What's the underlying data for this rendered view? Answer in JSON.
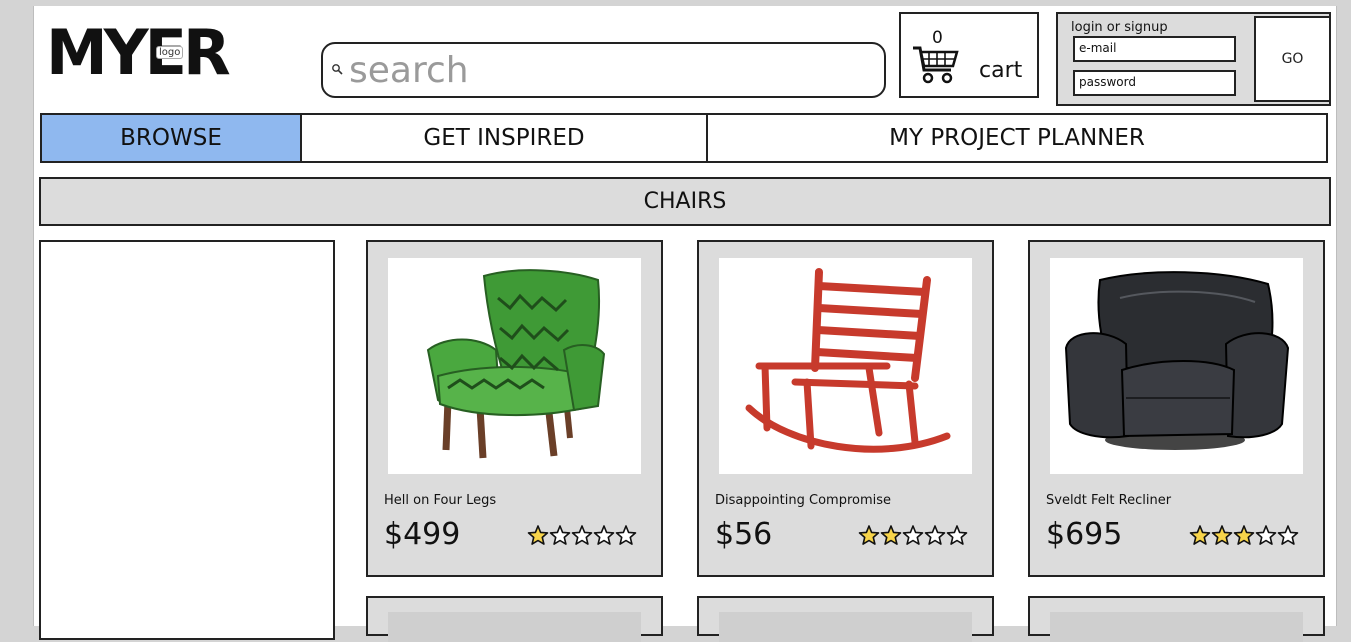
{
  "brand": {
    "logo_text": "MYER",
    "logo_tag": "logo"
  },
  "search": {
    "placeholder": "search"
  },
  "cart": {
    "count": "0",
    "label": "cart"
  },
  "login": {
    "title": "login or signup",
    "email_placeholder": "e-mail",
    "password_placeholder": "password",
    "go_label": "GO"
  },
  "nav": {
    "tabs": [
      {
        "label": "BROWSE",
        "active": true
      },
      {
        "label": "GET INSPIRED",
        "active": false
      },
      {
        "label": "MY PROJECT PLANNER",
        "active": false
      }
    ]
  },
  "category": {
    "title": "CHAIRS"
  },
  "products": [
    {
      "name": "Hell on Four Legs",
      "price": "$499",
      "rating": 1,
      "image": "green-wingback-armchair"
    },
    {
      "name": "Disappointing Compromise",
      "price": "$56",
      "rating": 2,
      "image": "red-rocking-chair"
    },
    {
      "name": "Sveldt Felt Recliner",
      "price": "$695",
      "rating": 3,
      "image": "black-leather-recliner"
    }
  ],
  "colors": {
    "active_tab": "#8fb8ef",
    "panel_bg": "#dcdcdc",
    "star_fill": "#f7d44a",
    "red_chair": "#c73a2c",
    "green_chair": "#3f9a36",
    "black_chair": "#2b2d31"
  }
}
